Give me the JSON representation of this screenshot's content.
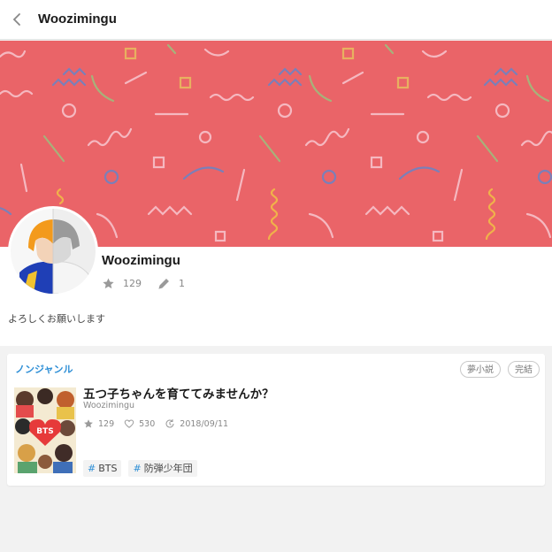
{
  "header": {
    "title": "Woozimingu",
    "back_icon": "chevron-left-icon"
  },
  "banner": {
    "background_color": "#ea6468"
  },
  "profile": {
    "name": "Woozimingu",
    "stars": "129",
    "works": "1",
    "bio": "よろしくお願いします"
  },
  "story_card": {
    "genre": "ノンジャンル",
    "badges": [
      "夢小説",
      "完結"
    ],
    "title": "五つ子ちゃんを育ててみませんか？",
    "author": "Woozimingu",
    "stars": "129",
    "likes": "530",
    "updated": "2018/09/11",
    "cover_text": "BTS",
    "tags": [
      "BTS",
      "防弾少年団"
    ],
    "tag_prefix": "#"
  },
  "colors": {
    "accent_blue": "#2e8fd6",
    "banner_red": "#ea6468"
  }
}
